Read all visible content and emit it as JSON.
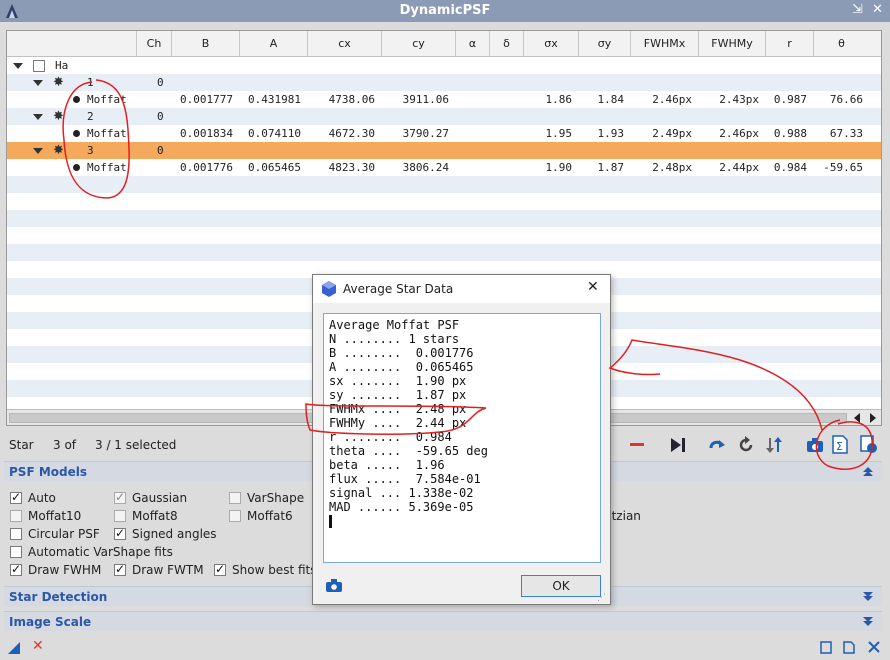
{
  "window": {
    "title": "DynamicPSF",
    "restore_glyph": "⇲",
    "close_glyph": "✕"
  },
  "columns": [
    "",
    "Ch",
    "B",
    "A",
    "cx",
    "cy",
    "α",
    "δ",
    "σx",
    "σy",
    "FWHMx",
    "FWHMy",
    "r",
    "θ"
  ],
  "tree": {
    "image": "Ha",
    "stars": [
      {
        "index": "1",
        "ch": "0",
        "fit": {
          "name": "Moffat",
          "B": "0.001777",
          "A": "0.431981",
          "cx": "4738.06",
          "cy": "3911.06",
          "sx": "1.86",
          "sy": "1.84",
          "fwhmx": "2.46px",
          "fwhmy": "2.43px",
          "r": "0.987",
          "theta": "76.66"
        }
      },
      {
        "index": "2",
        "ch": "0",
        "fit": {
          "name": "Moffat",
          "B": "0.001834",
          "A": "0.074110",
          "cx": "4672.30",
          "cy": "3790.27",
          "sx": "1.95",
          "sy": "1.93",
          "fwhmx": "2.49px",
          "fwhmy": "2.46px",
          "r": "0.988",
          "theta": "67.33"
        }
      },
      {
        "index": "3",
        "ch": "0",
        "fit": {
          "name": "Moffat",
          "B": "0.001776",
          "A": "0.065465",
          "cx": "4823.30",
          "cy": "3806.24",
          "sx": "1.90",
          "sy": "1.87",
          "fwhmx": "2.48px",
          "fwhmy": "2.44px",
          "r": "0.984",
          "theta": "-59.65"
        }
      }
    ]
  },
  "status": {
    "label": "Star",
    "position": "3 of",
    "selection": "3 / 1 selected"
  },
  "sections": {
    "psf_models": "PSF Models",
    "star_detection": "Star Detection",
    "image_scale": "Image Scale"
  },
  "options": {
    "auto": "Auto",
    "gaussian": "Gaussian",
    "varshape": "VarShape",
    "moffat10": "Moffat10",
    "moffat8": "Moffat8",
    "moffat6": "Moffat6",
    "lorentzian_partial": "ntzian",
    "circular_psf": "Circular PSF",
    "signed_angles": "Signed angles",
    "auto_varshape": "Automatic VarShape fits",
    "draw_fwhm": "Draw FWHM",
    "draw_fwtm": "Draw FWTM",
    "show_best_fits": "Show best fits"
  },
  "dialog": {
    "title": "Average Star Data",
    "lines": [
      "Average Moffat PSF",
      "N ........ 1 stars",
      "B ........  0.001776",
      "A ........  0.065465",
      "sx .......  1.90 px",
      "sy .......  1.87 px",
      "FWHMx ....  2.48 px",
      "FWHMy ....  2.44 px",
      "r ........  0.984",
      "theta ....  -59.65 deg",
      "beta .....  1.96",
      "flux .....  7.584e-01",
      "signal ... 1.338e-02",
      "MAD ...... 5.369e-05"
    ],
    "ok_label": "OK"
  },
  "colors": {
    "accent_blue": "#2a57a7",
    "selected_row": "#f5a95c",
    "annotation_red": "#e02020",
    "title_bar": "#8b9bb5"
  },
  "icons": [
    "psf-logo-icon",
    "restore-icon",
    "close-icon",
    "collapse-arrow-icon",
    "star-icon",
    "bullet-icon",
    "delete-icon",
    "next-icon",
    "redo-icon",
    "refresh-icon",
    "sort-icon",
    "camera-icon",
    "sigma-icon",
    "export-icon",
    "new-instance-icon",
    "reset-icon"
  ]
}
